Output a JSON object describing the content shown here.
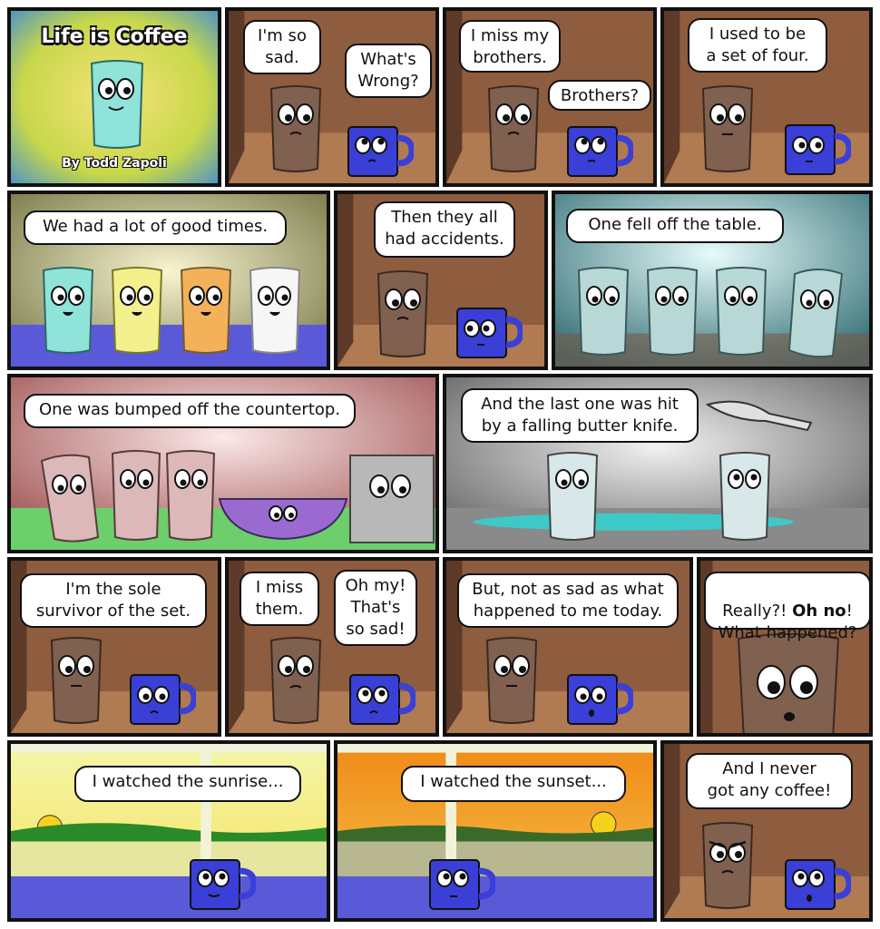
{
  "comic": {
    "title": "Life is Coffee",
    "author": "By Todd Zapoli",
    "colors": {
      "wood": "#8a5a3c",
      "mug_blue": "#3a3fd8",
      "glass_brown": "#7a5a4c",
      "teal": "#7fd6cc",
      "yellow": "#f4f08e",
      "orange": "#f3b15a",
      "white_glass": "#f4f4f4"
    },
    "panels": [
      {
        "id": "p2",
        "bubbles": [
          "I'm so\nsad.",
          "What's\nWrong?"
        ]
      },
      {
        "id": "p3",
        "bubbles": [
          "I miss my\nbrothers.",
          "Brothers?"
        ]
      },
      {
        "id": "p4",
        "bubbles": [
          "I used to be\na set of four."
        ]
      },
      {
        "id": "p5",
        "bubbles": [
          "We had a lot of good times."
        ]
      },
      {
        "id": "p6",
        "bubbles": [
          "Then they all\nhad accidents."
        ]
      },
      {
        "id": "p7",
        "bubbles": [
          "One fell off the table."
        ]
      },
      {
        "id": "p8",
        "bubbles": [
          "One was bumped off the countertop."
        ]
      },
      {
        "id": "p9",
        "bubbles": [
          "And the last one was hit\nby a falling butter knife."
        ]
      },
      {
        "id": "p10",
        "bubbles": [
          "I'm the sole\nsurvivor of the set."
        ]
      },
      {
        "id": "p11",
        "bubbles": [
          "I miss\nthem.",
          "Oh my!\nThat's\nso sad!"
        ]
      },
      {
        "id": "p12",
        "bubbles": [
          "But, not as sad as what\nhappened to me today."
        ]
      },
      {
        "id": "p13",
        "bubbles": [
          "Really?! ",
          "Oh no",
          "!\nWhat happened?"
        ]
      },
      {
        "id": "p14",
        "bubbles": [
          "I watched the sunrise..."
        ]
      },
      {
        "id": "p15",
        "bubbles": [
          "I watched the sunset..."
        ]
      },
      {
        "id": "p16",
        "bubbles": [
          "And I never\ngot any coffee!"
        ]
      }
    ]
  }
}
